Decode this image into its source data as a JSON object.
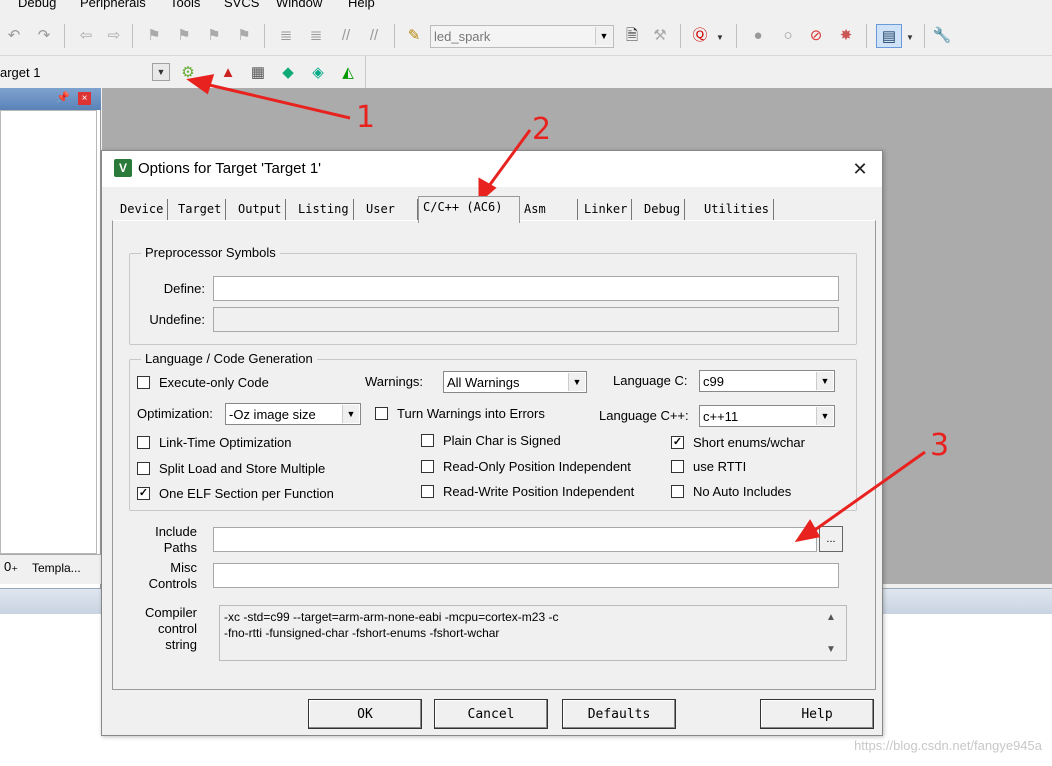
{
  "menubar": {
    "items": [
      "Debug",
      "Peripherals",
      "Tools",
      "SVCS",
      "Window",
      "Help"
    ]
  },
  "toolbar": {
    "project_combo_value": "led_spark",
    "target_combo_value": "arget 1"
  },
  "project_panel": {
    "tab_label": "Templa..."
  },
  "dialog": {
    "title": "Options for Target 'Target 1'",
    "tabs": [
      "Device",
      "Target",
      "Output",
      "Listing",
      "User",
      "C/C++ (AC6)",
      "Asm",
      "Linker",
      "Debug",
      "Utilities"
    ],
    "active_tab": "C/C++ (AC6)",
    "preprocessor": {
      "group_label": "Preprocessor Symbols",
      "define_label": "Define:",
      "define_value": "",
      "undefine_label": "Undefine:",
      "undefine_value": ""
    },
    "language": {
      "group_label": "Language / Code Generation",
      "execute_only": {
        "label": "Execute-only Code",
        "checked": false
      },
      "warnings_label": "Warnings:",
      "warnings_value": "All Warnings",
      "language_c_label": "Language C:",
      "language_c_value": "c99",
      "optimization_label": "Optimization:",
      "optimization_value": "-Oz image size",
      "turn_warnings": {
        "label": "Turn Warnings into Errors",
        "checked": false
      },
      "language_cpp_label": "Language C++:",
      "language_cpp_value": "c++11",
      "lto": {
        "label": "Link-Time Optimization",
        "checked": false
      },
      "plain_char": {
        "label": "Plain Char is Signed",
        "checked": false
      },
      "short_enums": {
        "label": "Short enums/wchar",
        "checked": true
      },
      "split_load": {
        "label": "Split Load and Store Multiple",
        "checked": false
      },
      "ropi": {
        "label": "Read-Only Position Independent",
        "checked": false
      },
      "rtti": {
        "label": "use RTTI",
        "checked": false
      },
      "one_elf": {
        "label": "One ELF Section per Function",
        "checked": true
      },
      "rwpi": {
        "label": "Read-Write Position Independent",
        "checked": false
      },
      "no_auto_includes": {
        "label": "No Auto Includes",
        "checked": false
      }
    },
    "include_paths_label_1": "Include",
    "include_paths_label_2": "Paths",
    "include_paths_value": "",
    "browse_label": "...",
    "misc_label_1": "Misc",
    "misc_label_2": "Controls",
    "misc_value": "",
    "compiler_label_1": "Compiler",
    "compiler_label_2": "control",
    "compiler_label_3": "string",
    "compiler_line_1": "-xc -std=c99 --target=arm-arm-none-eabi -mcpu=cortex-m23 -c",
    "compiler_line_2": "-fno-rtti -funsigned-char -fshort-enums -fshort-wchar",
    "buttons": {
      "ok": "OK",
      "cancel": "Cancel",
      "defaults": "Defaults",
      "help": "Help"
    },
    "close_glyph": "✕",
    "check_glyph": "✓"
  },
  "annotations": {
    "arrow_color": "#e8231f",
    "labels": [
      "1",
      "2",
      "3"
    ]
  },
  "watermark": "https://blog.csdn.net/fangye945a"
}
